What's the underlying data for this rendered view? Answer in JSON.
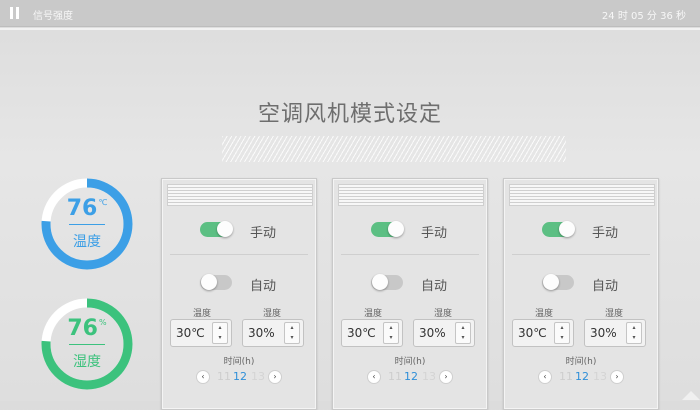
{
  "status_bar": {
    "signal_label": "信号强度",
    "clock": "24 时 05 分 36 秒"
  },
  "page": {
    "title": "空调风机模式设定"
  },
  "gauges": [
    {
      "value": "76",
      "unit": "℃",
      "label": "温度",
      "level": 0.76,
      "color": "#3c9fe6"
    },
    {
      "value": "76",
      "unit": "%",
      "label": "湿度",
      "level": 0.76,
      "color": "#3cc27d"
    }
  ],
  "panels": [
    {
      "manual": {
        "label": "手动",
        "on": true
      },
      "auto": {
        "label": "自动",
        "on": false
      },
      "temp": {
        "label": "温度",
        "value": "30℃"
      },
      "humidity": {
        "label": "湿度",
        "value": "30%"
      },
      "time": {
        "label": "时间(h)",
        "hours": [
          "11",
          "12",
          "13"
        ]
      }
    },
    {
      "manual": {
        "label": "手动",
        "on": true
      },
      "auto": {
        "label": "自动",
        "on": false
      },
      "temp": {
        "label": "温度",
        "value": "30℃"
      },
      "humidity": {
        "label": "湿度",
        "value": "30%"
      },
      "time": {
        "label": "时间(h)",
        "hours": [
          "11",
          "12",
          "13"
        ]
      }
    },
    {
      "manual": {
        "label": "手动",
        "on": true
      },
      "auto": {
        "label": "自动",
        "on": false
      },
      "temp": {
        "label": "温度",
        "value": "30℃"
      },
      "humidity": {
        "label": "湿度",
        "value": "30%"
      },
      "time": {
        "label": "时间(h)",
        "hours": [
          "11",
          "12",
          "13"
        ]
      }
    }
  ],
  "icons": {
    "signal": "signal-icon",
    "step_up": "▴",
    "step_down": "▾",
    "prev": "‹",
    "next": "›"
  }
}
